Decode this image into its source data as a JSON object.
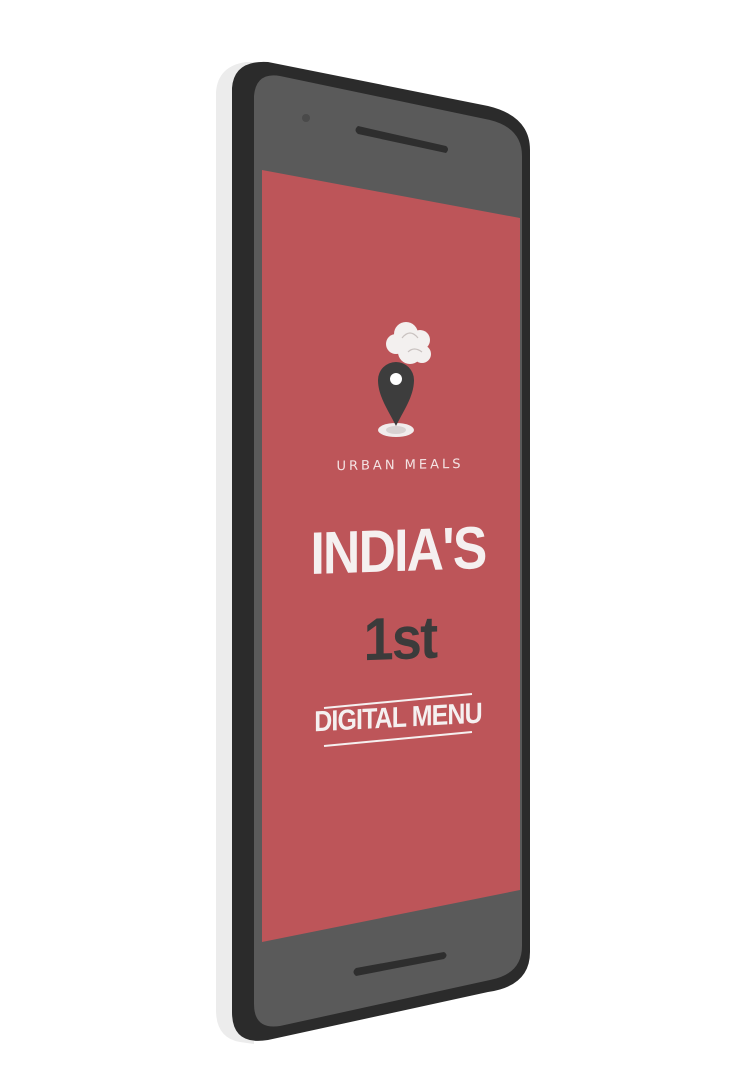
{
  "splash": {
    "brand_name": "URBAN MEALS",
    "headline": "INDIA'S",
    "ordinal": "1st",
    "tagline": "DIGITAL MENU"
  },
  "colors": {
    "screen_background": "#bd5559",
    "headline_text": "#f5f0f0",
    "ordinal_text": "#3b3b3b",
    "phone_body": "#2a2a2a",
    "phone_bezel": "#595959"
  },
  "icons": {
    "logo": "chef-hat-location-pin-icon"
  }
}
